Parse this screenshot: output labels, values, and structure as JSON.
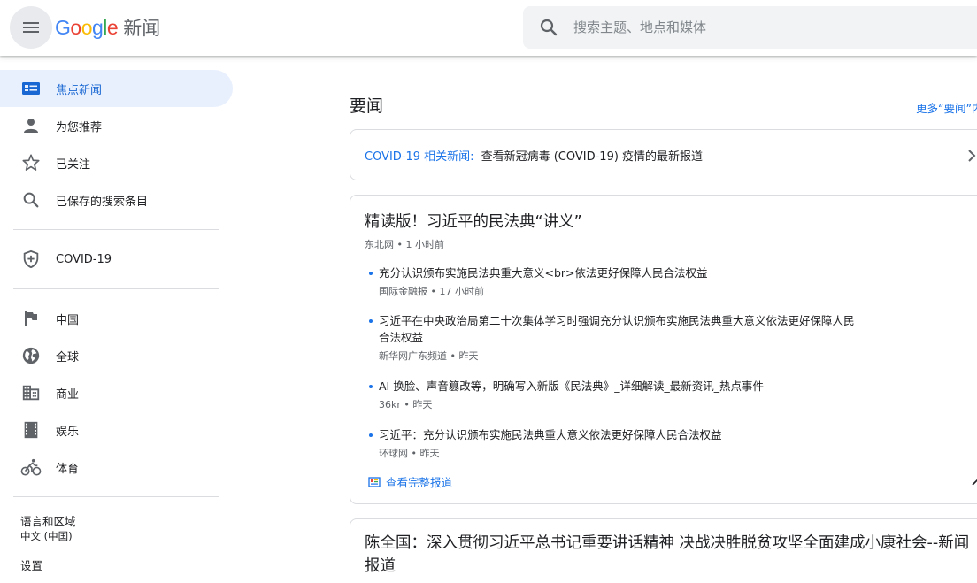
{
  "header": {
    "logo_letters": [
      "G",
      "o",
      "o",
      "g",
      "l",
      "e"
    ],
    "logo_colors": [
      "#4285f4",
      "#ea4335",
      "#fbbc05",
      "#4285f4",
      "#34a853",
      "#ea4335"
    ],
    "product": "新闻",
    "search_placeholder": "搜索主题、地点和媒体"
  },
  "sidebar": {
    "items": [
      {
        "label": "焦点新闻",
        "icon": "headlines-icon",
        "active": true
      },
      {
        "label": "为您推荐",
        "icon": "person-icon"
      },
      {
        "label": "已关注",
        "icon": "star-icon"
      },
      {
        "label": "已保存的搜索条目",
        "icon": "search-icon"
      },
      {
        "label": "COVID-19",
        "icon": "shield-plus-icon"
      },
      {
        "label": "中国",
        "icon": "flag-icon"
      },
      {
        "label": "全球",
        "icon": "globe-icon"
      },
      {
        "label": "商业",
        "icon": "building-icon"
      },
      {
        "label": "娱乐",
        "icon": "film-icon"
      },
      {
        "label": "体育",
        "icon": "bike-icon"
      }
    ],
    "language_label": "语言和区域",
    "language_value": "中文 (中国)",
    "settings": "设置"
  },
  "main": {
    "section_title": "要闻",
    "more_link": "更多“要闻”内容",
    "covid_prefix": "COVID-19 相关新闻:",
    "covid_text": "查看新冠病毒 (COVID-19) 疫情的最新报道",
    "story": {
      "title": "精读版！习近平的民法典“讲义”",
      "source": "东北网",
      "time": "1 小时前",
      "subs": [
        {
          "title": "充分认识颁布实施民法典重大意义<br>依法更好保障人民合法权益",
          "source": "国际金融报",
          "time": "17 小时前"
        },
        {
          "title": "习近平在中央政治局第二十次集体学习时强调充分认识颁布实施民法典重大意义依法更好保障人民合法权益",
          "source": "新华网广东频道",
          "time": "昨天"
        },
        {
          "title": "AI 换脸、声音篡改等，明确写入新版《民法典》_详细解读_最新资讯_热点事件",
          "source": "36kr",
          "time": "昨天"
        },
        {
          "title": "习近平：充分认识颁布实施民法典重大意义依法更好保障人民合法权益",
          "source": "环球网",
          "time": "昨天"
        }
      ],
      "full_coverage": "查看完整报道"
    },
    "story2_title": "陈全国：深入贯彻习近平总书记重要讲话精神 决战决胜脱贫攻坚全面建成小康社会--新闻报道"
  },
  "colors": {
    "accent": "#1a73e8",
    "active_bg": "#e8f0fe",
    "icon": "#5f6368"
  }
}
